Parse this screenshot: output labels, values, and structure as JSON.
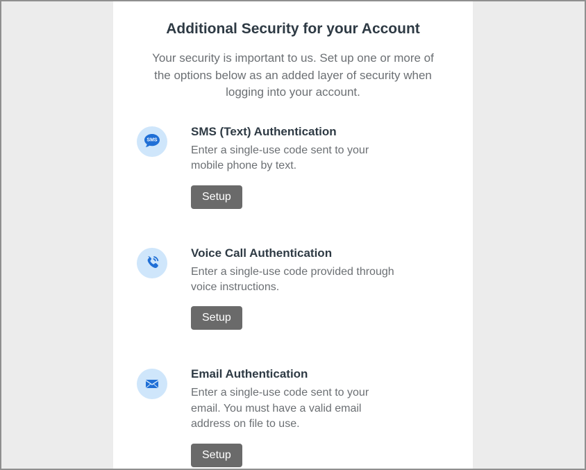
{
  "header": {
    "title": "Additional Security for your Account",
    "subtitle": "Your security is important to us. Set up one or more of the options below as an added layer of security when logging into your account."
  },
  "options": {
    "sms": {
      "title": "SMS (Text) Authentication",
      "desc": "Enter a single-use code sent to your mobile phone by text.",
      "button": "Setup"
    },
    "voice": {
      "title": "Voice Call Authentication",
      "desc": "Enter a single-use code provided through voice instructions.",
      "button": "Setup"
    },
    "email": {
      "title": "Email Authentication",
      "desc": "Enter a single-use code sent to your email. You must have a valid email address on file to use.",
      "button": "Setup"
    }
  }
}
